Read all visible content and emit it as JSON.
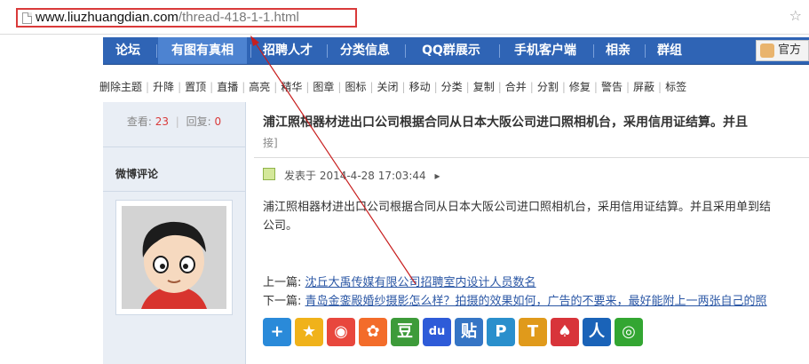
{
  "browser": {
    "url_host": "www.liuzhuangdian.com",
    "url_path": "/thread-418-1-1.html"
  },
  "nav": {
    "items": [
      "论坛",
      "有图有真相",
      "招聘人才",
      "分类信息",
      "QQ群展示",
      "手机客户端",
      "相亲",
      "群组"
    ],
    "active_index": 1,
    "right_label": "官方",
    "colors": {
      "bar": "#2f64b5",
      "active": "#4d83d1"
    }
  },
  "moderation": {
    "items": [
      "删除主题",
      "升降",
      "置顶",
      "直播",
      "高亮",
      "精华",
      "图章",
      "图标",
      "关闭",
      "移动",
      "分类",
      "复制",
      "合并",
      "分割",
      "修复",
      "警告",
      "屏蔽",
      "标签"
    ]
  },
  "sidebar": {
    "views_label": "查看:",
    "views": "23",
    "replies_label": "回复:",
    "replies": "0",
    "weibo_title": "微博评论"
  },
  "post": {
    "title": "浦江照相器材进出口公司根据合同从日本大阪公司进口照相机台，采用信用证结算。并且",
    "subtitle": "接]",
    "meta": "发表于 2014-4-28 17:03:44",
    "body_line1": "浦江照相器材进出口公司根据合同从日本大阪公司进口照相机台，采用信用证结算。并且采用单到结",
    "body_line2": "公司。",
    "prev_label": "上一篇:",
    "prev_link": "沈丘大禹传媒有限公司招聘室内设计人员数名",
    "next_label": "下一篇:",
    "next_link": "青岛金銮殿婚纱摄影怎么样？拍摄的效果如何，广告的不要来，最好能附上一两张自己的照"
  },
  "share": [
    {
      "icon": "plus-share-icon",
      "glyph": "+",
      "color": "#2a8ad9"
    },
    {
      "icon": "qzone-icon",
      "glyph": "★",
      "color": "#f0b21a"
    },
    {
      "icon": "weibo-icon",
      "glyph": "◉",
      "color": "#e8473d"
    },
    {
      "icon": "pengyou-icon",
      "glyph": "✿",
      "color": "#f36c2a"
    },
    {
      "icon": "douban-icon",
      "glyph": "豆",
      "color": "#3d9b3a"
    },
    {
      "icon": "baidu-icon",
      "glyph": "du",
      "color": "#2e5bd8"
    },
    {
      "icon": "tieba-icon",
      "glyph": "贴",
      "color": "#3575c5"
    },
    {
      "icon": "renren-social-icon",
      "glyph": "P",
      "color": "#2a8fcc"
    },
    {
      "icon": "tianya-icon",
      "glyph": "T",
      "color": "#e09a1b"
    },
    {
      "icon": "kaixin-icon",
      "glyph": "♠",
      "color": "#d8343a"
    },
    {
      "icon": "renren-icon",
      "glyph": "人",
      "color": "#1a63b8"
    },
    {
      "icon": "wechat-icon",
      "glyph": "◎",
      "color": "#33a632"
    }
  ],
  "annotation_color": "#c81e1e"
}
